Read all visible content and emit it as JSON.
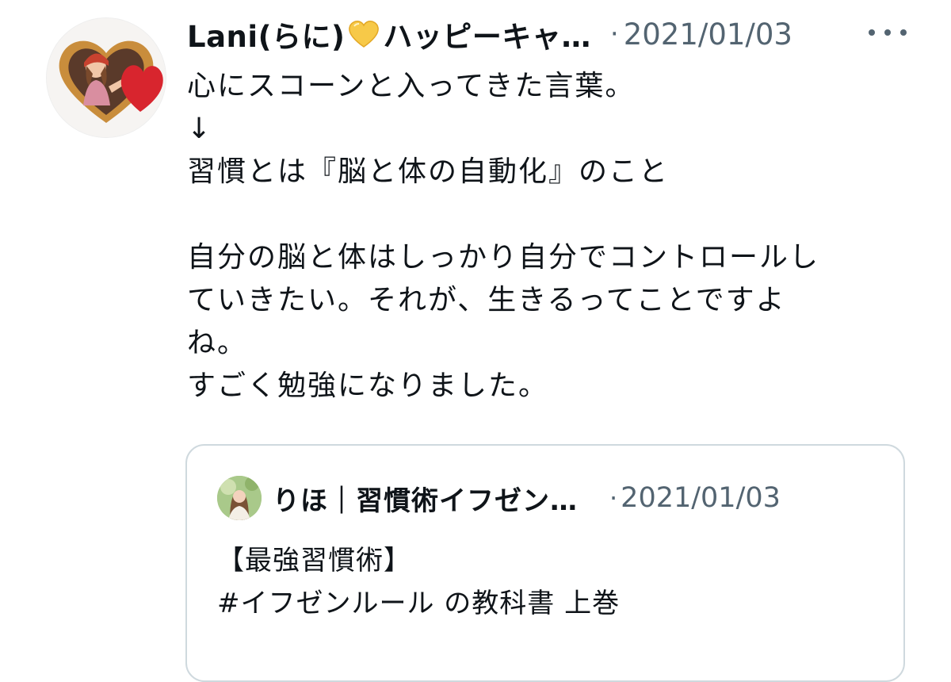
{
  "tweet": {
    "display_name": "Lani(らに)",
    "display_name_suffix": "ハッピーキャ…",
    "name_emoji_icon": "yellow-heart-icon",
    "dot": "·",
    "timestamp": "2021/01/03",
    "more_icon": "more-horizontal-icon",
    "body_lines": [
      "心にスコーンと入ってきた言葉。",
      "↓",
      "習慣とは『脳と体の自動化』のこと",
      "",
      "自分の脳と体はしっかり自分でコントロールし",
      "ていきたい。それが、生きるってことですよ",
      "ね。",
      "すごく勉強になりました。"
    ]
  },
  "quote": {
    "display_name": "りほ｜習慣術イフゼン…",
    "dot": "·",
    "timestamp": "2021/01/03",
    "text_lines": [
      "【最強習慣術】",
      "#イフゼンルール の教科書 上巻"
    ]
  },
  "colors": {
    "text_primary": "#0f1419",
    "text_secondary": "#536471",
    "card_border": "#cfd9de",
    "heart_yellow": "#f7c948"
  }
}
